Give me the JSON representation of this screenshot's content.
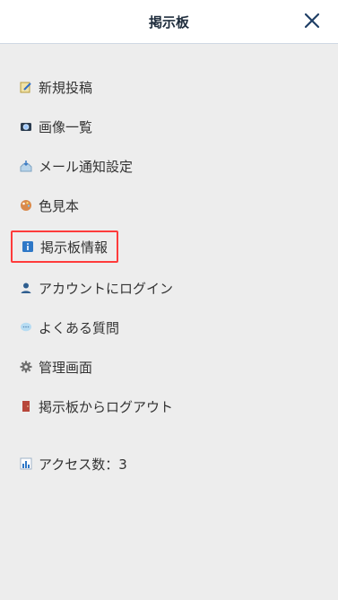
{
  "header": {
    "title": "掲示板",
    "close_icon": "close-icon"
  },
  "menu": {
    "items": [
      {
        "label": "新規投稿",
        "icon": "pencil-note-icon"
      },
      {
        "label": "画像一覧",
        "icon": "camera-icon"
      },
      {
        "label": "メール通知設定",
        "icon": "inbox-icon"
      },
      {
        "label": "色見本",
        "icon": "palette-icon"
      },
      {
        "label": "掲示板情報",
        "icon": "info-icon",
        "highlighted": true
      },
      {
        "label": "アカウントにログイン",
        "icon": "user-icon"
      },
      {
        "label": "よくある質問",
        "icon": "speech-bubble-icon"
      },
      {
        "label": "管理画面",
        "icon": "gear-icon"
      },
      {
        "label": "掲示板からログアウト",
        "icon": "door-icon"
      }
    ],
    "access_count": {
      "label": "アクセス数：3",
      "icon": "bar-chart-icon"
    }
  },
  "colors": {
    "highlight_border": "#ff3b3b",
    "background": "#ededed"
  }
}
